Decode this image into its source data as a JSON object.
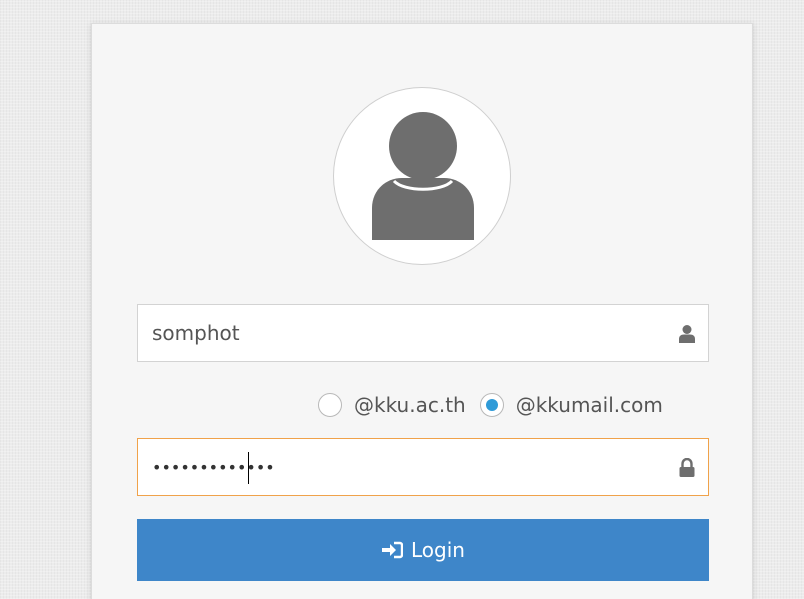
{
  "login": {
    "username_value": "somphot",
    "password_mask": "•••••••••••••",
    "domain_options": [
      {
        "label": "@kku.ac.th",
        "checked": false
      },
      {
        "label": "@kkumail.com",
        "checked": true
      }
    ],
    "login_label": "Login"
  },
  "icons": {
    "avatar": "user-avatar-icon",
    "username": "user-icon",
    "password": "lock-icon",
    "login": "sign-in-icon"
  },
  "colors": {
    "button_bg": "#3e86c9",
    "radio_checked": "#2f9bd8",
    "focus_border": "#f0a24a",
    "icon_gray": "#6e6e6e"
  }
}
